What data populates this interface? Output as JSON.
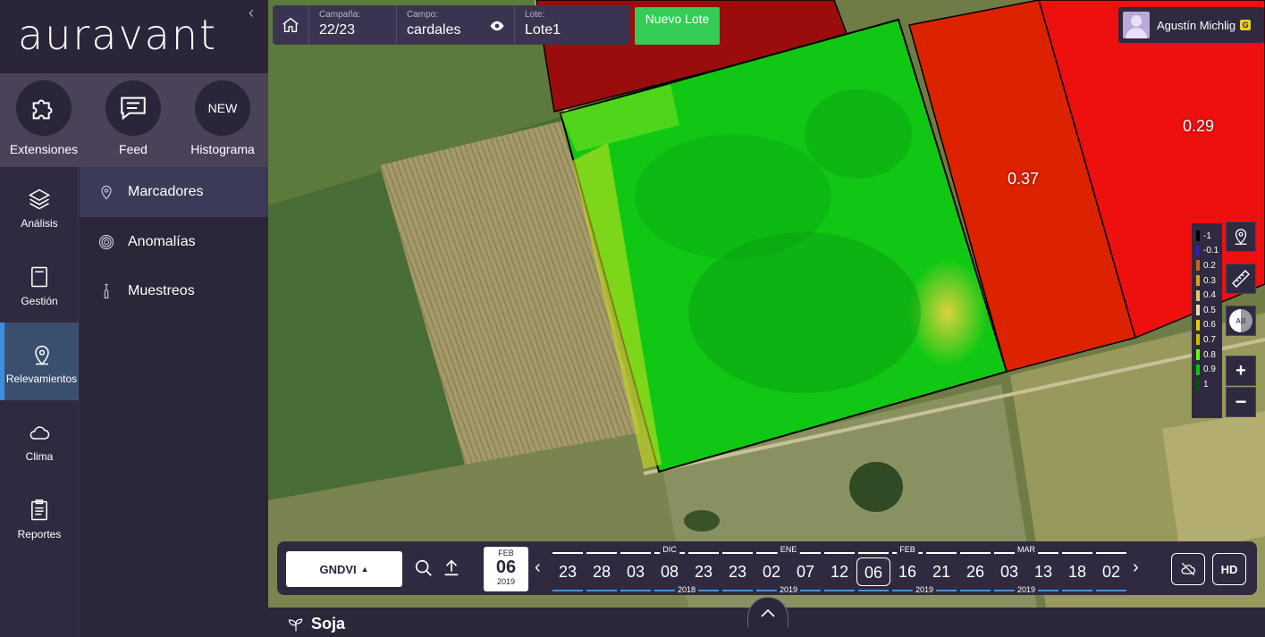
{
  "logo": "auravant",
  "quick_actions": [
    {
      "label": "Extensiones",
      "icon": "puzzle-icon"
    },
    {
      "label": "Feed",
      "icon": "chat-icon"
    },
    {
      "label": "Histograma",
      "icon": "new-badge",
      "badge": "NEW"
    }
  ],
  "nav": [
    {
      "label": "Análisis",
      "icon": "layers-icon"
    },
    {
      "label": "Gestión",
      "icon": "notebook-icon"
    },
    {
      "label": "Relevamientos",
      "icon": "location-pin-icon",
      "active": true
    },
    {
      "label": "Clima",
      "icon": "cloud-icon"
    },
    {
      "label": "Reportes",
      "icon": "clipboard-icon"
    }
  ],
  "subnav": [
    {
      "label": "Marcadores",
      "icon": "marker-icon",
      "active": true
    },
    {
      "label": "Anomalías",
      "icon": "anomaly-icon"
    },
    {
      "label": "Muestreos",
      "icon": "sample-icon"
    }
  ],
  "breadcrumb": {
    "campaign_caption": "Campaña:",
    "campaign": "22/23",
    "field_caption": "Campo:",
    "field": "cardales",
    "lot_caption": "Lote:",
    "lot": "Lote1"
  },
  "new_lot": "Nuevo Lote",
  "user": {
    "name": "Agustín Michlig",
    "badge": "G"
  },
  "lot_values": [
    "0.37",
    "0.29"
  ],
  "legend": [
    {
      "label": "-1",
      "color": "#000000"
    },
    {
      "label": "-0.1",
      "color": "#3a1ab0"
    },
    {
      "label": "0.2",
      "color": "#c8641e"
    },
    {
      "label": "0.3",
      "color": "#e0a020"
    },
    {
      "label": "0.4",
      "color": "#e6c870"
    },
    {
      "label": "0.5",
      "color": "#f0e0a8"
    },
    {
      "label": "0.6",
      "color": "#e8d000"
    },
    {
      "label": "0.7",
      "color": "#c8c000"
    },
    {
      "label": "0.8",
      "color": "#66ff00"
    },
    {
      "label": "0.9",
      "color": "#00cc00"
    },
    {
      "label": "1",
      "color": "#005a00"
    }
  ],
  "colors": {
    "accent_green": "#33cc55",
    "nav_active": "#3e8ee0",
    "sidebar": "#2f2a3f"
  },
  "timeline": {
    "index": "GNDVI",
    "selected": {
      "month": "FEB",
      "day": "06",
      "year": "2019"
    },
    "dates": [
      "23",
      "28",
      "03",
      "08",
      "23",
      "23",
      "02",
      "07",
      "12",
      "06",
      "16",
      "21",
      "26",
      "03",
      "13",
      "18",
      "02"
    ],
    "active_index": 9,
    "months": [
      {
        "label": "DIC",
        "at": 3.5
      },
      {
        "label": "ENE",
        "at": 7
      },
      {
        "label": "FEB",
        "at": 10.5
      },
      {
        "label": "MAR",
        "at": 14
      }
    ],
    "years": [
      {
        "label": "2018",
        "at": 4
      },
      {
        "label": "2019",
        "at": 7
      },
      {
        "label": "2019",
        "at": 11
      },
      {
        "label": "2019",
        "at": 14
      }
    ],
    "hd": "HD"
  },
  "crop": "Soja"
}
